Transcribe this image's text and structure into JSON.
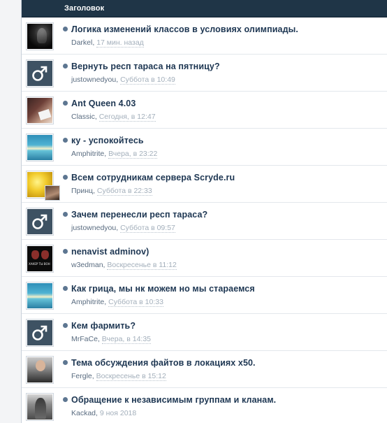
{
  "header": {
    "column_label": "Заголовок"
  },
  "topics": [
    {
      "title": "Логика изменений классов в условиях олимпиады.",
      "author": "Darkel",
      "time": "17 мин. назад",
      "avatar": "dark-bird-avatar"
    },
    {
      "title": "Вернуть респ тараса на пятницу?",
      "author": "justownedyou",
      "time": "Суббота в 10:49",
      "avatar": "male-icon"
    },
    {
      "title": "Ant Queen 4.03",
      "author": "Classic",
      "time": "Сегодня, в 12:47",
      "avatar": "girl-photo-avatar"
    },
    {
      "title": "ку - успокойтесь",
      "author": "Amphitrite",
      "time": "Вчера, в 23:22",
      "avatar": "seascape-avatar"
    },
    {
      "title": "Всем сотрудникам сервера Scryde.ru",
      "author": "Принц",
      "time": "Суббота в 22:33",
      "avatar": "golden-avatar"
    },
    {
      "title": "Зачем перенесли респ тараса?",
      "author": "justownedyou",
      "time": "Суббота в 09:57",
      "avatar": "male-icon"
    },
    {
      "title": "nenavist adminov)",
      "author": "w3edman",
      "time": "Воскресенье в 11:12",
      "avatar": "black-poster-avatar"
    },
    {
      "title": "Как грица, мы нк можем но мы стараемся",
      "author": "Amphitrite",
      "time": "Суббота в 10:33",
      "avatar": "seascape-avatar"
    },
    {
      "title": "Кем фармить?",
      "author": "MrFaCe",
      "time": "Вчера, в 14:35",
      "avatar": "male-icon"
    },
    {
      "title": "Тема обсуждения файтов в локациях х50.",
      "author": "Fergle",
      "time": "Воскресенье в 15:12",
      "avatar": "man-photo-avatar"
    },
    {
      "title": "Обращение к независимым группам и кланам.",
      "author": "Kackad",
      "time": "9 ноя 2018",
      "avatar": "knight-avatar"
    }
  ]
}
